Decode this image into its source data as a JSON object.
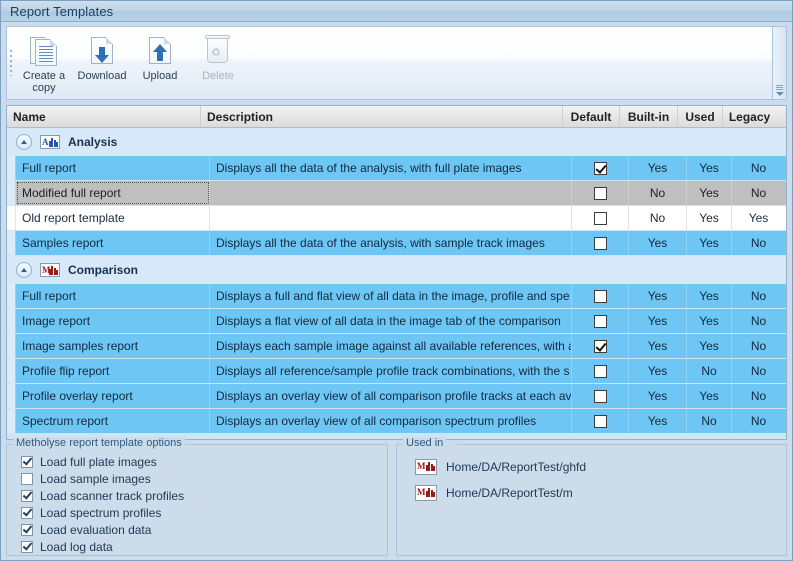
{
  "window": {
    "title": "Report Templates"
  },
  "toolbar": {
    "buttons": [
      {
        "label": "Create a\ncopy",
        "label_line1": "Create a",
        "label_line2": "copy",
        "icon": "copy-document-icon",
        "disabled": false
      },
      {
        "label": "Download",
        "icon": "download-document-icon",
        "disabled": false
      },
      {
        "label": "Upload",
        "icon": "upload-document-icon",
        "disabled": false
      },
      {
        "label": "Delete",
        "icon": "trash-icon",
        "disabled": true
      }
    ]
  },
  "grid": {
    "columns": [
      "Name",
      "Description",
      "Default",
      "Built-in",
      "Used",
      "Legacy"
    ],
    "groups": [
      {
        "label": "Analysis",
        "icon": "analysis-chart-icon",
        "icon_letter": "A",
        "icon_color": "#2457a8",
        "rows": [
          {
            "name": "Full report",
            "description": "Displays all the data of the analysis, with full plate images",
            "default": true,
            "builtin": "Yes",
            "used": "Yes",
            "legacy": "No",
            "state": "sel"
          },
          {
            "name": "Modified full report",
            "description": "",
            "default": false,
            "builtin": "No",
            "used": "Yes",
            "legacy": "No",
            "state": "focus"
          },
          {
            "name": "Old report template",
            "description": "",
            "default": false,
            "builtin": "No",
            "used": "Yes",
            "legacy": "Yes",
            "state": "plain"
          },
          {
            "name": "Samples report",
            "description": "Displays all the data of the analysis, with sample track images",
            "default": false,
            "builtin": "Yes",
            "used": "Yes",
            "legacy": "No",
            "state": "sel"
          }
        ]
      },
      {
        "label": "Comparison",
        "icon": "comparison-chart-icon",
        "icon_letter": "M",
        "icon_color": "#9b1b1b",
        "rows": [
          {
            "name": "Full report",
            "description": "Displays a full and flat view of all data in the image, profile and spe",
            "default": false,
            "builtin": "Yes",
            "used": "Yes",
            "legacy": "No",
            "state": "sel"
          },
          {
            "name": "Image report",
            "description": "Displays a flat view of all data in the image tab of the comparison",
            "default": false,
            "builtin": "Yes",
            "used": "Yes",
            "legacy": "No",
            "state": "sel"
          },
          {
            "name": "Image samples report",
            "description": "Displays each sample image against all available references, with a",
            "default": true,
            "builtin": "Yes",
            "used": "Yes",
            "legacy": "No",
            "state": "sel"
          },
          {
            "name": "Profile flip report",
            "description": "Displays all reference/sample profile track combinations, with the s",
            "default": false,
            "builtin": "Yes",
            "used": "No",
            "legacy": "No",
            "state": "sel"
          },
          {
            "name": "Profile overlay report",
            "description": "Displays an overlay view of all comparison profile tracks at each av",
            "default": false,
            "builtin": "Yes",
            "used": "Yes",
            "legacy": "No",
            "state": "sel"
          },
          {
            "name": "Spectrum report",
            "description": "Displays an overlay view of all comparison spectrum profiles",
            "default": false,
            "builtin": "Yes",
            "used": "No",
            "legacy": "No",
            "state": "sel"
          }
        ]
      }
    ]
  },
  "options_panel": {
    "legend": "Metholyse report template options",
    "items": [
      {
        "label": "Load full plate images",
        "checked": true
      },
      {
        "label": "Load sample images",
        "checked": false
      },
      {
        "label": "Load scanner track profiles",
        "checked": true
      },
      {
        "label": "Load spectrum profiles",
        "checked": true
      },
      {
        "label": "Load evaluation data",
        "checked": true
      },
      {
        "label": "Load log data",
        "checked": true
      }
    ]
  },
  "used_in_panel": {
    "legend": "Used in",
    "items": [
      {
        "path": "Home/DA/ReportTest/ghfd",
        "icon": "comparison-chart-icon"
      },
      {
        "path": "Home/DA/ReportTest/m",
        "icon": "comparison-chart-icon"
      }
    ]
  },
  "colors": {
    "selection": "#6ec6f5",
    "focus_row": "#bfbfbf",
    "group_header": "#d7e9f9",
    "window_bg": "#ccdcea",
    "accent": "#2457a8"
  }
}
